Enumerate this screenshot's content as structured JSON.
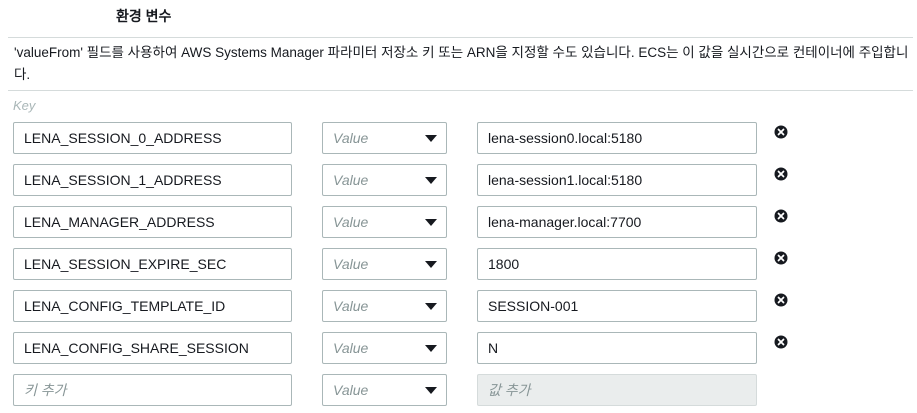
{
  "section": {
    "title": "환경 변수",
    "description": "'valueFrom' 필드를 사용하여 AWS Systems Manager 파라미터 저장소 키 또는 ARN을 지정할 수도 있습니다. ECS는 이 값을 실시간으로 컨테이너에 주입합니다.",
    "key_header": "Key"
  },
  "rows": [
    {
      "key": "LENA_SESSION_0_ADDRESS",
      "value_type": "Value",
      "value": "lena-session0.local:5180"
    },
    {
      "key": "LENA_SESSION_1_ADDRESS",
      "value_type": "Value",
      "value": "lena-session1.local:5180"
    },
    {
      "key": "LENA_MANAGER_ADDRESS",
      "value_type": "Value",
      "value": "lena-manager.local:7700"
    },
    {
      "key": "LENA_SESSION_EXPIRE_SEC",
      "value_type": "Value",
      "value": "1800"
    },
    {
      "key": "LENA_CONFIG_TEMPLATE_ID",
      "value_type": "Value",
      "value": "SESSION-001"
    },
    {
      "key": "LENA_CONFIG_SHARE_SESSION",
      "value_type": "Value",
      "value": "N"
    }
  ],
  "new_row": {
    "key_placeholder": "키 추가",
    "value_type": "Value",
    "value_placeholder": "값 추가"
  },
  "icons": {
    "remove": "remove-circle-icon",
    "dropdown": "caret-down-icon"
  },
  "colors": {
    "border": "#aab7b8",
    "placeholder": "#879596",
    "disabled_bg": "#eaeded"
  }
}
